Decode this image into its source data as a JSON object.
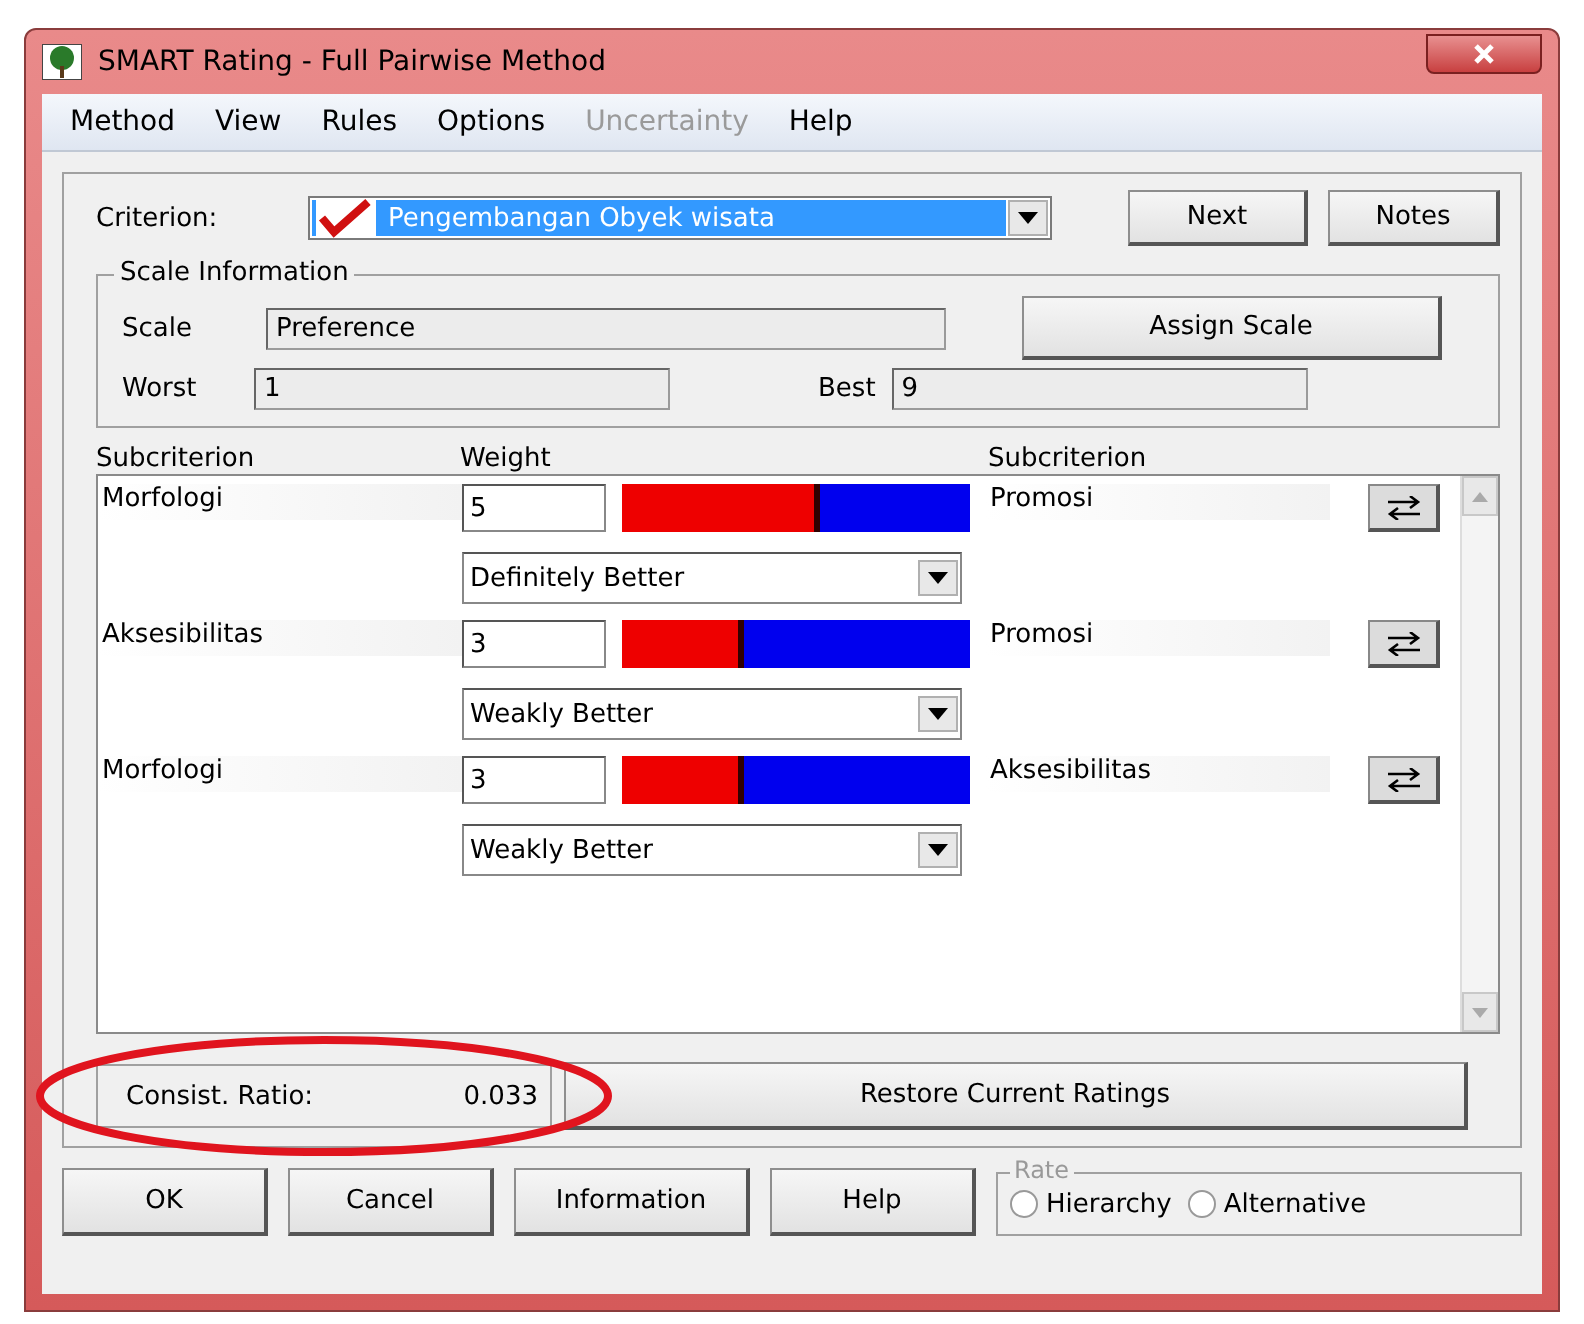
{
  "window": {
    "title": "SMART Rating - Full Pairwise Method"
  },
  "menu": [
    {
      "label": "Method",
      "disabled": false
    },
    {
      "label": "View",
      "disabled": false
    },
    {
      "label": "Rules",
      "disabled": false
    },
    {
      "label": "Options",
      "disabled": false
    },
    {
      "label": "Uncertainty",
      "disabled": true
    },
    {
      "label": "Help",
      "disabled": false
    }
  ],
  "criterion": {
    "label": "Criterion:",
    "value": "Pengembangan Obyek wisata",
    "focused": true
  },
  "top_buttons": [
    {
      "label": "Next"
    },
    {
      "label": "Notes"
    }
  ],
  "scale_info": {
    "title": "Scale Information",
    "scale_label": "Scale",
    "scale_value": "Preference",
    "assign_button": {
      "label": "Assign Scale"
    },
    "worst_label": "Worst",
    "worst_value": "1",
    "best_label": "Best",
    "best_value": "9"
  },
  "columns": [
    "Subcriterion",
    "Weight",
    "Subcriterion"
  ],
  "comparisons": [
    {
      "left": "Morfologi",
      "weight": "5",
      "level": 0.57,
      "verbal": "Definitely Better",
      "right": "Promosi"
    },
    {
      "left": "Aksesibilitas",
      "weight": "3",
      "level": 0.35,
      "verbal": "Weakly Better",
      "right": "Promosi"
    },
    {
      "left": "Morfologi",
      "weight": "3",
      "level": 0.35,
      "verbal": "Weakly Better",
      "right": "Aksesibilitas"
    }
  ],
  "consistency": {
    "label": "Consist. Ratio:",
    "value": "0.033",
    "highlighted": true
  },
  "restore_button": {
    "label": "Restore Current Ratings"
  },
  "bottom_buttons": [
    {
      "label": "OK"
    },
    {
      "label": "Cancel"
    },
    {
      "label": "Information"
    },
    {
      "label": "Help"
    }
  ],
  "rate": {
    "title": "Rate",
    "options": [
      {
        "label": "Hierarchy",
        "selected": false
      },
      {
        "label": "Alternative",
        "selected": false
      }
    ]
  }
}
